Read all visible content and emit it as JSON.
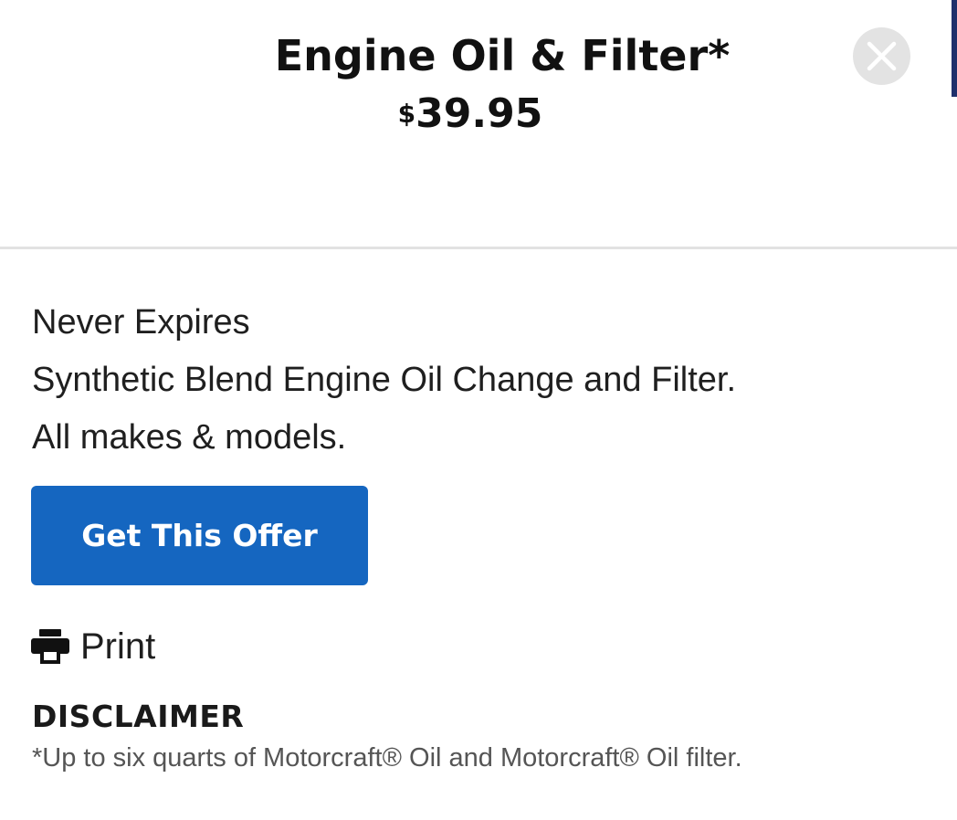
{
  "offer": {
    "title": "Engine Oil & Filter*",
    "price_currency": "$",
    "price_amount": "39.95"
  },
  "details": {
    "lines": [
      "Never Expires",
      "Synthetic Blend Engine Oil Change and Filter.",
      "All makes & models."
    ]
  },
  "actions": {
    "cta_label": "Get This Offer",
    "print_label": "Print",
    "close_icon": "close-icon",
    "print_icon": "printer-icon"
  },
  "disclaimer": {
    "heading": "DISCLAIMER",
    "text": "*Up to six quarts of Motorcraft® Oil and Motorcraft® Oil filter."
  },
  "colors": {
    "cta_background": "#1566c0",
    "close_background": "#e3e3e3",
    "accent_edge": "#1f2f6b"
  }
}
